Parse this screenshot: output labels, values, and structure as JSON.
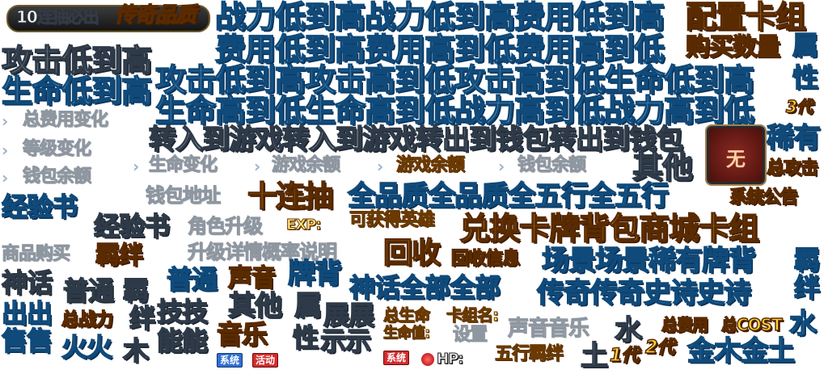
{
  "banner": {
    "prefix": "10连抽必出",
    "highlight": "传奇品质"
  },
  "rows": [
    "战力低到高战力低到高费用低到高",
    "费用低到高费用高到低费用高到低",
    "攻击低到高",
    "生命低到高",
    "攻击低到高攻击高到低攻击高到低生命低到高",
    "生命高到低生命高到低战力高到低战力高到低",
    "转入到游戏转入到游戏转出到钱包转出到钱包"
  ],
  "labels": {
    "config_deck": "配置卡组",
    "buy_count": "购买数量",
    "attr": "属",
    "nature": "性",
    "gen3": "3代",
    "rare": "稀有",
    "total_attack": "总攻击",
    "wu": "无",
    "other": "其他",
    "total_cost_change": "总费用变化",
    "level_change": "等级变化",
    "wallet_balance": "钱包余额",
    "life_change": "生命变化",
    "game_balance": "游戏余额",
    "game_balance_gold": "游戏余额",
    "wallet_balance2": "钱包余额",
    "exp_book": "经验书",
    "wallet_address": "钱包地址",
    "ten_draw": "十连抽",
    "all_quality": "全品质全品质全五行全五行",
    "system_notice": "系统公告",
    "exp_book2": "经验书",
    "role_upgrade": "角色升级",
    "exp": "EXP:",
    "can_get_hero": "可获得英雄",
    "exchange": "兑换卡牌背包商城卡组",
    "shop_buy": "商品购买",
    "fetter": "羁绊",
    "upgrade_detail": "升级详情概率说明",
    "recycle": "回收",
    "recycle_info": "回收信息",
    "scene": "场景场景稀有牌背",
    "fetter_r": "羁",
    "myth": "神话",
    "normal": "普通",
    "normal2": "普通",
    "sound": "声音",
    "card_back": "牌背",
    "myth_all": "神话全部全部",
    "legend_epic": "传奇传奇史诗史诗",
    "jie": "绊",
    "sell": "出出",
    "total_power": "总战力",
    "fetter_vert": "羁",
    "jie2": "绊",
    "skill": "技技",
    "other2": "其他",
    "attr2": "属",
    "sell2": "售售",
    "fire": "火火",
    "wood": "木",
    "neng": "能能",
    "music": "音乐",
    "xing": "性",
    "show": "展展",
    "shi": "示示",
    "total_life": "总生命",
    "card_name": "卡组名:",
    "life_val": "生命值:",
    "settings": "设置",
    "sound_music": "声音音乐",
    "water": "水",
    "total_cost": "总费用",
    "total_cost_en": "总COST",
    "water2": "水",
    "five_fetter": "五行羁绊",
    "earth": "土",
    "gen1": "1代",
    "gen2": "2代",
    "metal_wood": "金木金土",
    "hp": "HP:",
    "badge_system": "系统",
    "badge_event": "活动",
    "badge_system2": "系统"
  }
}
